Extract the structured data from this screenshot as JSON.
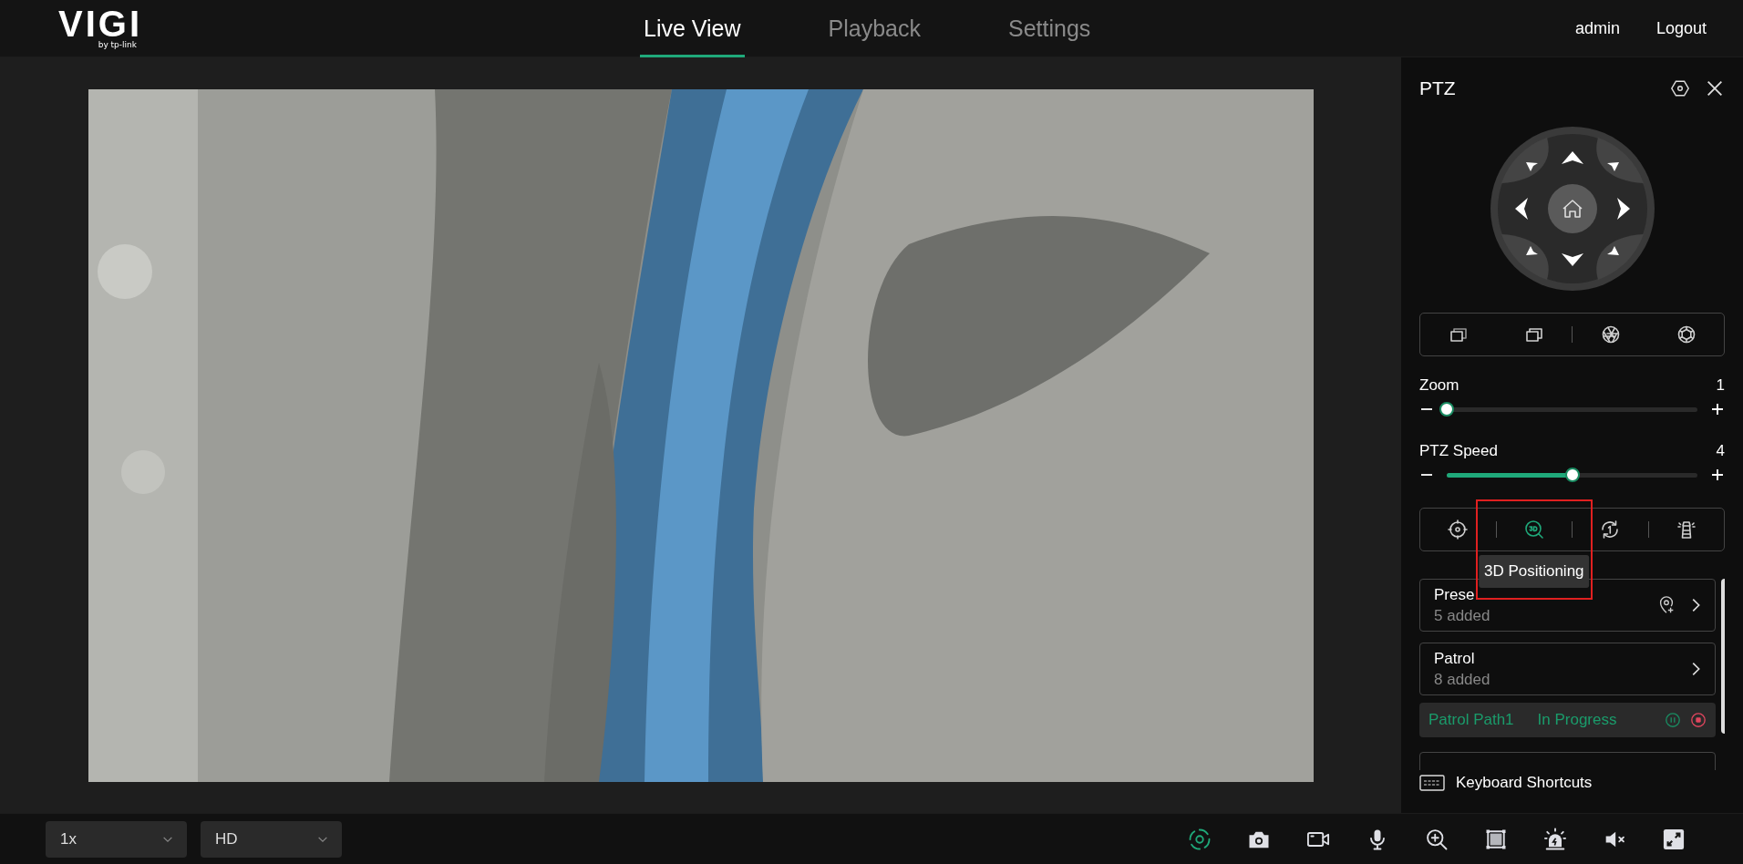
{
  "header": {
    "logo": "VIGI",
    "logo_sub": "by tp-link",
    "tabs": [
      {
        "label": "Live View",
        "selected": true
      },
      {
        "label": "Playback",
        "selected": false
      },
      {
        "label": "Settings",
        "selected": false
      }
    ],
    "user": "admin",
    "logout": "Logout"
  },
  "ptz": {
    "title": "PTZ",
    "lens_buttons": [
      {
        "kind": "zoom-out"
      },
      {
        "kind": "zoom-in"
      },
      {
        "kind": "iris-open"
      },
      {
        "kind": "iris-close"
      }
    ],
    "sliders": [
      {
        "label": "Zoom",
        "reading": "1",
        "level": 0
      },
      {
        "label": "PTZ Speed",
        "reading": "4",
        "level": 0.5
      }
    ],
    "tools": [
      {
        "kind": "target",
        "selected": false
      },
      {
        "kind": "positioning",
        "selected": true
      },
      {
        "kind": "cycle",
        "selected": false
      },
      {
        "kind": "light",
        "selected": false
      }
    ],
    "tooltip": "3D Positioning",
    "cards": [
      {
        "title": "Prese",
        "count": "5 added",
        "can_add": true
      },
      {
        "title": "Patrol",
        "count": "8 added",
        "can_add": false
      }
    ],
    "patrol_run": {
      "path": "Patrol Path1",
      "status": "In Progress"
    },
    "shortcuts": "Keyboard Shortcuts"
  },
  "bottom_bar": {
    "selects": [
      {
        "value": "1x"
      },
      {
        "value": "HD"
      }
    ],
    "tools": [
      {
        "kind": "track",
        "on": true
      },
      {
        "kind": "snapshot",
        "on": false
      },
      {
        "kind": "record",
        "on": false
      },
      {
        "kind": "mic",
        "on": false
      },
      {
        "kind": "zoom",
        "on": false
      },
      {
        "kind": "frame",
        "on": false
      },
      {
        "kind": "alarm",
        "on": false
      },
      {
        "kind": "mute",
        "on": false
      },
      {
        "kind": "fullscreen",
        "on": false
      }
    ]
  }
}
